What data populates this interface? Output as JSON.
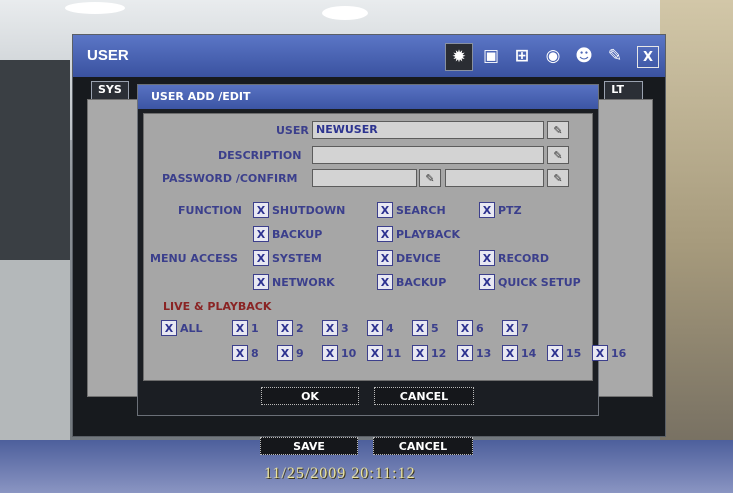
{
  "window": {
    "title": "USER",
    "tab_left": "SYS",
    "tab_right": "LT",
    "toolbar_icons": [
      "gear-icon",
      "monitor-icon",
      "network-icon",
      "globe-icon",
      "users-icon",
      "tools-icon"
    ],
    "save_label": "SAVE",
    "cancel_label": "CANCEL",
    "close_glyph": "X"
  },
  "dialog": {
    "title": "USER ADD /EDIT",
    "user_label": "USER",
    "user_value": "NEWUSER",
    "description_label": "DESCRIPTION",
    "description_value": "",
    "password_label": "PASSWORD /CONFIRM",
    "password_value": "",
    "confirm_value": "",
    "function_label": "FUNCTION",
    "function_items": [
      "SHUTDOWN",
      "SEARCH",
      "PTZ",
      "BACKUP",
      "PLAYBACK"
    ],
    "menu_access_label": "MENU ACCESS",
    "menu_items": [
      "SYSTEM",
      "DEVICE",
      "RECORD",
      "NETWORK",
      "BACKUP",
      "QUICK SETUP"
    ],
    "live_playback_label": "LIVE & PLAYBACK",
    "live_all_label": "ALL",
    "channels": [
      "1",
      "2",
      "3",
      "4",
      "5",
      "6",
      "7",
      "8",
      "9",
      "10",
      "11",
      "12",
      "13",
      "14",
      "15",
      "16"
    ],
    "check_mark": "X",
    "ok_label": "OK",
    "cancel_label": "CANCEL"
  },
  "timestamp": "11/25/2009 20:11:12",
  "colors": {
    "title_bar": "#3a52a0",
    "panel_bg": "#a6a6a6",
    "label_text": "#3b3f8c",
    "live_label_text": "#8a2424"
  }
}
